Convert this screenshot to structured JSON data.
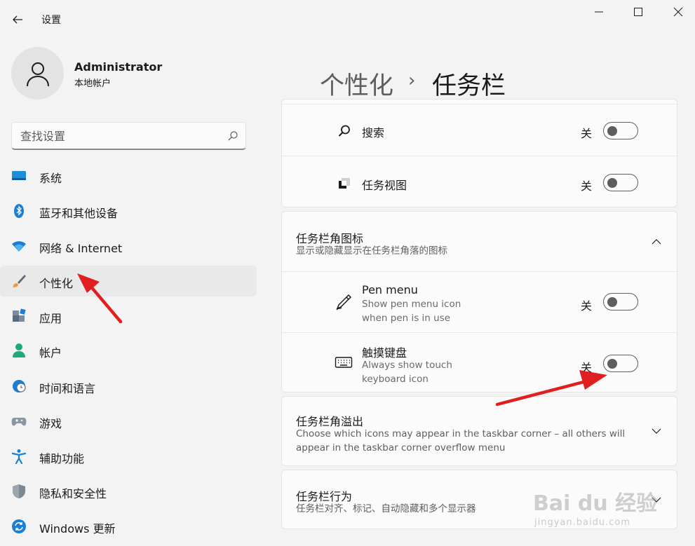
{
  "window": {
    "title": "设置",
    "controls": {
      "minimize": "minimize-icon",
      "maximize": "maximize-icon",
      "close": "close-icon"
    }
  },
  "profile": {
    "name": "Administrator",
    "account_type": "本地帐户"
  },
  "search": {
    "placeholder": "查找设置"
  },
  "sidebar": {
    "items": [
      {
        "label": "系统",
        "icon": "system-icon"
      },
      {
        "label": "蓝牙和其他设备",
        "icon": "bluetooth-icon"
      },
      {
        "label": "网络 & Internet",
        "icon": "wifi-icon"
      },
      {
        "label": "个性化",
        "icon": "brush-icon",
        "active": true
      },
      {
        "label": "应用",
        "icon": "apps-icon"
      },
      {
        "label": "帐户",
        "icon": "account-icon"
      },
      {
        "label": "时间和语言",
        "icon": "globe-clock-icon"
      },
      {
        "label": "游戏",
        "icon": "gamepad-icon"
      },
      {
        "label": "辅助功能",
        "icon": "accessibility-icon"
      },
      {
        "label": "隐私和安全性",
        "icon": "shield-icon"
      },
      {
        "label": "Windows 更新",
        "icon": "update-icon"
      }
    ]
  },
  "breadcrumb": {
    "parent": "个性化",
    "separator": "›",
    "current": "任务栏"
  },
  "taskbar_items": {
    "rows": [
      {
        "title": "搜索",
        "state": "关",
        "icon": "search-icon"
      },
      {
        "title": "任务视图",
        "state": "关",
        "icon": "task-view-icon"
      }
    ]
  },
  "corner_icons": {
    "title": "任务栏角图标",
    "subtitle": "显示或隐藏显示在任务栏角落的图标",
    "rows": [
      {
        "title": "Pen menu",
        "desc_line1": "Show pen menu icon",
        "desc_line2": "when pen is in use",
        "state": "关",
        "icon": "pen-icon"
      },
      {
        "title": "触摸键盘",
        "desc_line1": "Always show touch",
        "desc_line2": "keyboard icon",
        "state": "关",
        "icon": "keyboard-icon"
      }
    ]
  },
  "corner_overflow": {
    "title": "任务栏角溢出",
    "desc_line1": "Choose which icons may appear in the taskbar corner – all others will",
    "desc_line2": "appear in the taskbar corner overflow menu"
  },
  "behaviors": {
    "title": "任务栏行为",
    "subtitle": "任务栏对齐、标记、自动隐藏和多个显示器"
  },
  "watermark": {
    "main": "Bai du 经验",
    "sub": "jingyan.baidu.com"
  },
  "colors": {
    "accent": "#0b5ea8",
    "annotation_arrow": "#e02020"
  }
}
